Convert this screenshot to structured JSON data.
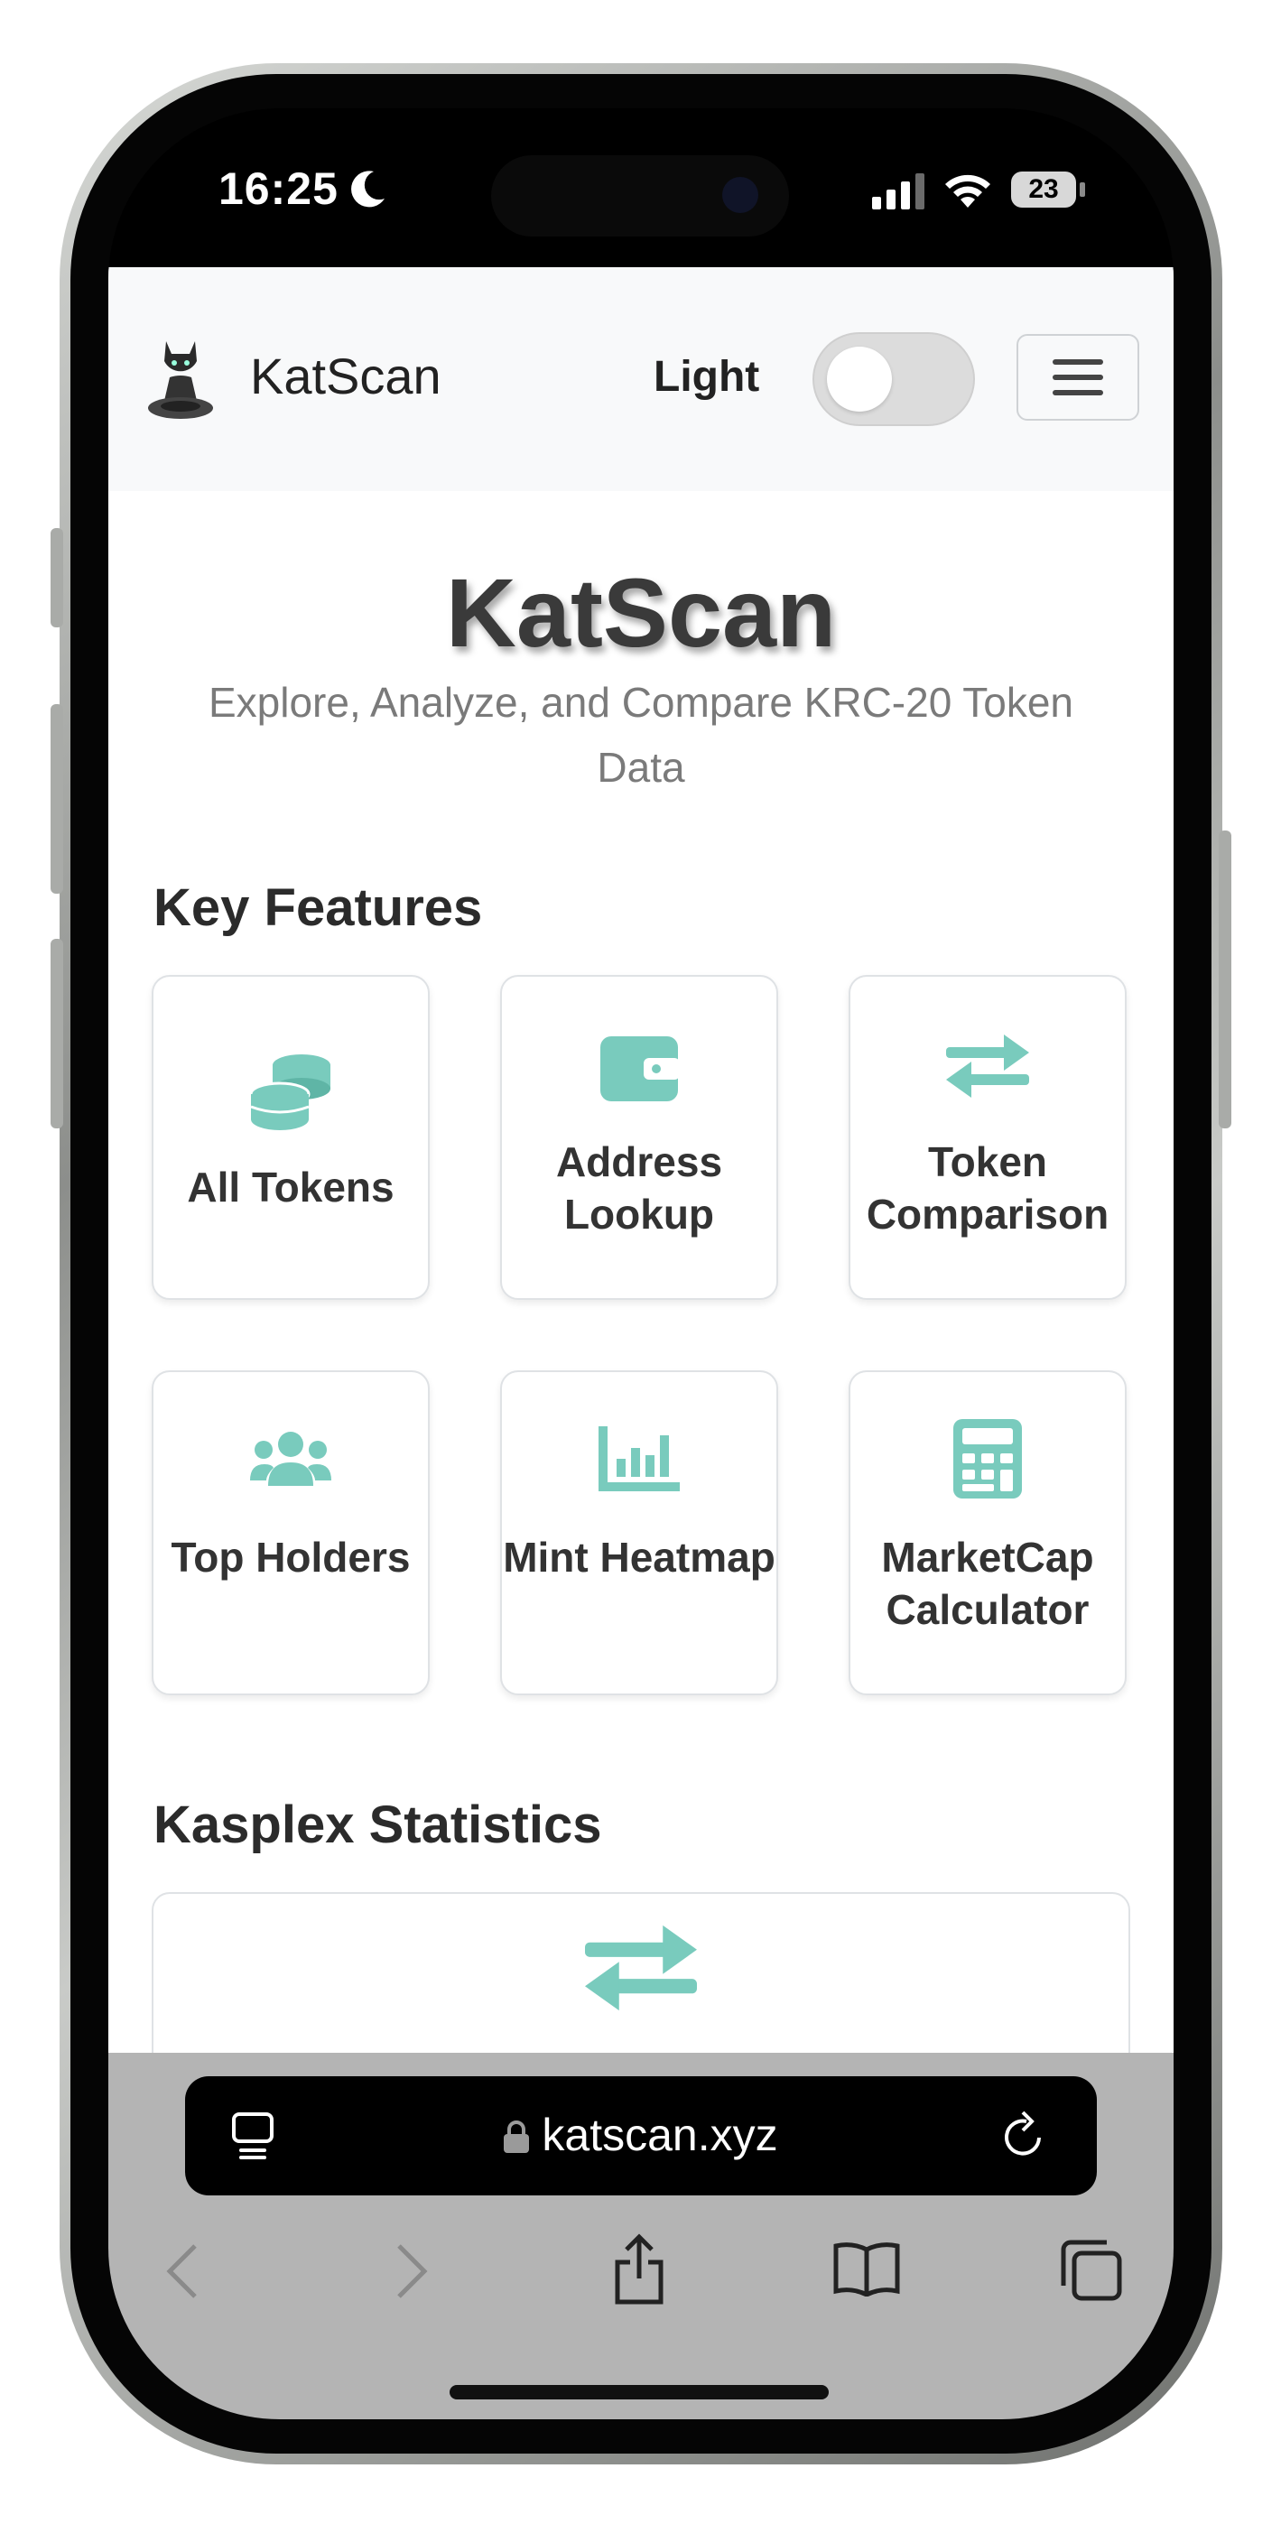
{
  "status": {
    "time": "16:25",
    "battery": "23"
  },
  "navbar": {
    "brand": "KatScan",
    "theme_label": "Light"
  },
  "hero": {
    "title": "KatScan",
    "subtitle": "Explore, Analyze, and Compare KRC-20 Token Data"
  },
  "features": {
    "title": "Key Features",
    "items": [
      {
        "label": "All Tokens",
        "icon": "coins-icon"
      },
      {
        "label": "Address Lookup",
        "icon": "wallet-icon"
      },
      {
        "label": "Token Comparison",
        "icon": "exchange-arrows-icon"
      },
      {
        "label": "Top Holders",
        "icon": "users-icon"
      },
      {
        "label": "Mint Heatmap",
        "icon": "bar-chart-icon"
      },
      {
        "label": "MarketCap Calculator",
        "icon": "calculator-icon"
      }
    ]
  },
  "stats": {
    "title": "Kasplex Statistics"
  },
  "browser": {
    "url": "katscan.xyz"
  },
  "colors": {
    "accent": "#79cbbd",
    "text": "#333333",
    "muted": "#7a7a7a"
  }
}
